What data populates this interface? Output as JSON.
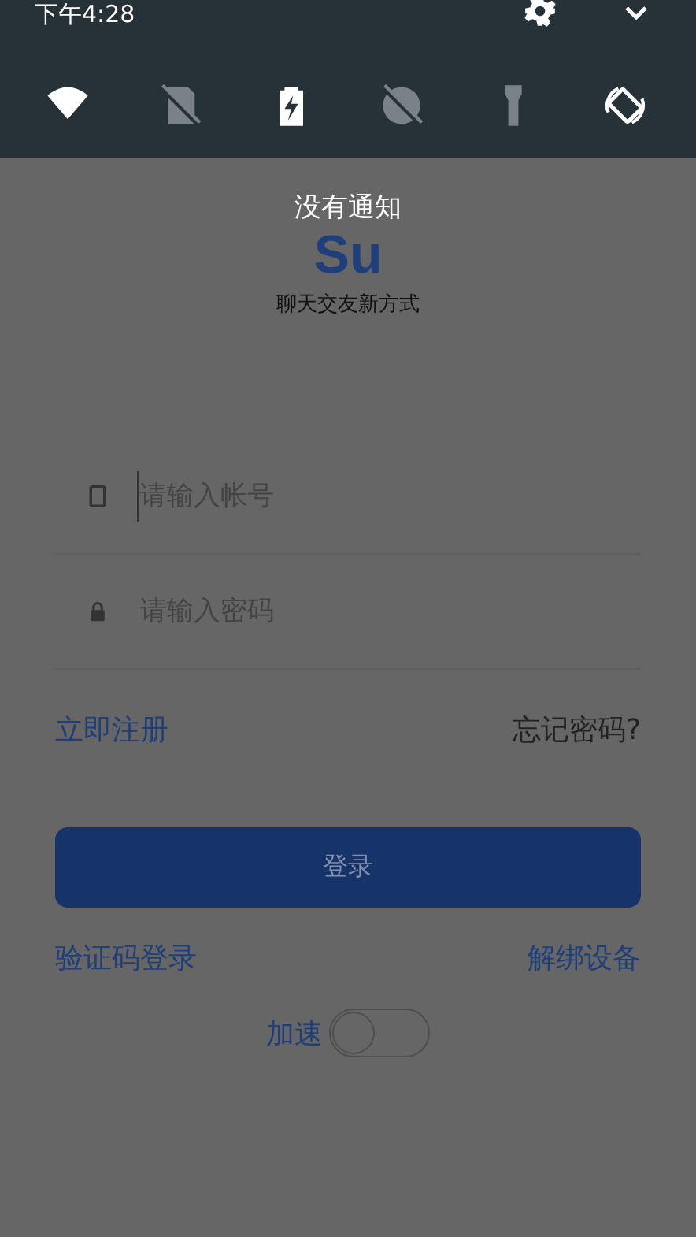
{
  "status_bar": {
    "time": "下午4:28"
  },
  "quick_settings": [
    {
      "kind": "wifi",
      "on": true
    },
    {
      "kind": "sim",
      "on": false
    },
    {
      "kind": "battery-saver",
      "on": true
    },
    {
      "kind": "do-not-disturb",
      "on": false
    },
    {
      "kind": "flashlight",
      "on": false
    },
    {
      "kind": "auto-rotate",
      "on": true
    }
  ],
  "notification_text": "没有通知",
  "app": {
    "logo": "Su",
    "tagline": "聊天交友新方式"
  },
  "fields": [
    {
      "kind": "account",
      "placeholder": "请输入帐号",
      "focused": true
    },
    {
      "kind": "password",
      "placeholder": "请输入密码",
      "focused": false
    }
  ],
  "links_row_1": [
    {
      "label": "立即注册",
      "kind": "accent"
    },
    {
      "label": "忘记密码?",
      "kind": "plain"
    }
  ],
  "login_button": "登录",
  "links_row_2": [
    {
      "label": "验证码登录",
      "kind": "accent"
    },
    {
      "label": "解绑设备",
      "kind": "accent"
    }
  ],
  "speedup": {
    "label": "加速",
    "on": false
  }
}
